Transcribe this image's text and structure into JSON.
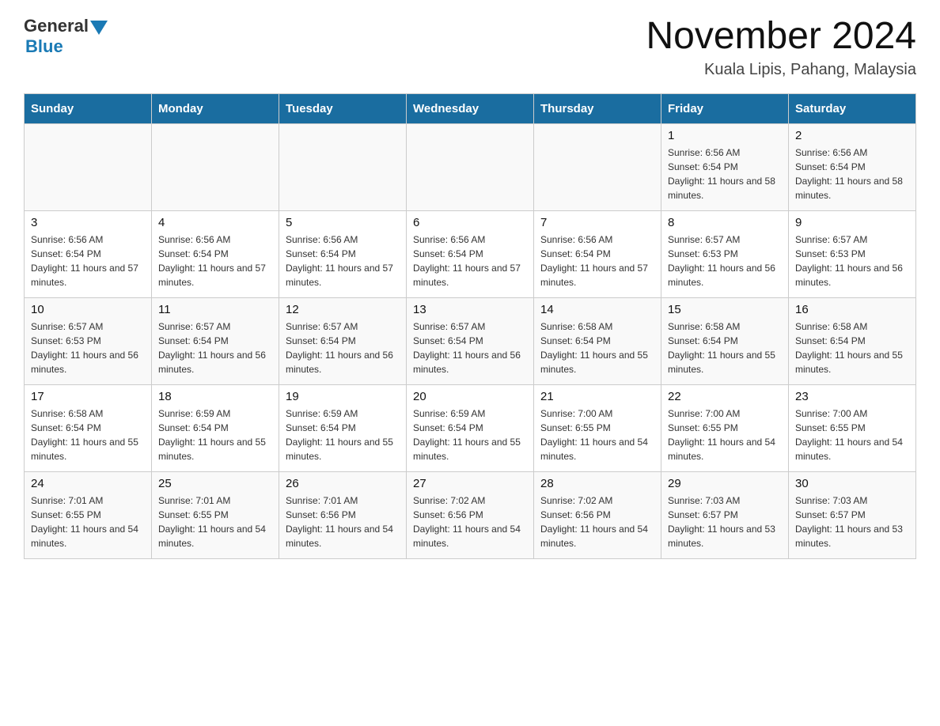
{
  "header": {
    "logo": {
      "general": "General",
      "arrow": "▶",
      "blue": "Blue"
    },
    "title": "November 2024",
    "location": "Kuala Lipis, Pahang, Malaysia"
  },
  "weekdays": [
    "Sunday",
    "Monday",
    "Tuesday",
    "Wednesday",
    "Thursday",
    "Friday",
    "Saturday"
  ],
  "weeks": [
    {
      "days": [
        {
          "date": "",
          "info": ""
        },
        {
          "date": "",
          "info": ""
        },
        {
          "date": "",
          "info": ""
        },
        {
          "date": "",
          "info": ""
        },
        {
          "date": "",
          "info": ""
        },
        {
          "date": "1",
          "info": "Sunrise: 6:56 AM\nSunset: 6:54 PM\nDaylight: 11 hours and 58 minutes."
        },
        {
          "date": "2",
          "info": "Sunrise: 6:56 AM\nSunset: 6:54 PM\nDaylight: 11 hours and 58 minutes."
        }
      ]
    },
    {
      "days": [
        {
          "date": "3",
          "info": "Sunrise: 6:56 AM\nSunset: 6:54 PM\nDaylight: 11 hours and 57 minutes."
        },
        {
          "date": "4",
          "info": "Sunrise: 6:56 AM\nSunset: 6:54 PM\nDaylight: 11 hours and 57 minutes."
        },
        {
          "date": "5",
          "info": "Sunrise: 6:56 AM\nSunset: 6:54 PM\nDaylight: 11 hours and 57 minutes."
        },
        {
          "date": "6",
          "info": "Sunrise: 6:56 AM\nSunset: 6:54 PM\nDaylight: 11 hours and 57 minutes."
        },
        {
          "date": "7",
          "info": "Sunrise: 6:56 AM\nSunset: 6:54 PM\nDaylight: 11 hours and 57 minutes."
        },
        {
          "date": "8",
          "info": "Sunrise: 6:57 AM\nSunset: 6:53 PM\nDaylight: 11 hours and 56 minutes."
        },
        {
          "date": "9",
          "info": "Sunrise: 6:57 AM\nSunset: 6:53 PM\nDaylight: 11 hours and 56 minutes."
        }
      ]
    },
    {
      "days": [
        {
          "date": "10",
          "info": "Sunrise: 6:57 AM\nSunset: 6:53 PM\nDaylight: 11 hours and 56 minutes."
        },
        {
          "date": "11",
          "info": "Sunrise: 6:57 AM\nSunset: 6:54 PM\nDaylight: 11 hours and 56 minutes."
        },
        {
          "date": "12",
          "info": "Sunrise: 6:57 AM\nSunset: 6:54 PM\nDaylight: 11 hours and 56 minutes."
        },
        {
          "date": "13",
          "info": "Sunrise: 6:57 AM\nSunset: 6:54 PM\nDaylight: 11 hours and 56 minutes."
        },
        {
          "date": "14",
          "info": "Sunrise: 6:58 AM\nSunset: 6:54 PM\nDaylight: 11 hours and 55 minutes."
        },
        {
          "date": "15",
          "info": "Sunrise: 6:58 AM\nSunset: 6:54 PM\nDaylight: 11 hours and 55 minutes."
        },
        {
          "date": "16",
          "info": "Sunrise: 6:58 AM\nSunset: 6:54 PM\nDaylight: 11 hours and 55 minutes."
        }
      ]
    },
    {
      "days": [
        {
          "date": "17",
          "info": "Sunrise: 6:58 AM\nSunset: 6:54 PM\nDaylight: 11 hours and 55 minutes."
        },
        {
          "date": "18",
          "info": "Sunrise: 6:59 AM\nSunset: 6:54 PM\nDaylight: 11 hours and 55 minutes."
        },
        {
          "date": "19",
          "info": "Sunrise: 6:59 AM\nSunset: 6:54 PM\nDaylight: 11 hours and 55 minutes."
        },
        {
          "date": "20",
          "info": "Sunrise: 6:59 AM\nSunset: 6:54 PM\nDaylight: 11 hours and 55 minutes."
        },
        {
          "date": "21",
          "info": "Sunrise: 7:00 AM\nSunset: 6:55 PM\nDaylight: 11 hours and 54 minutes."
        },
        {
          "date": "22",
          "info": "Sunrise: 7:00 AM\nSunset: 6:55 PM\nDaylight: 11 hours and 54 minutes."
        },
        {
          "date": "23",
          "info": "Sunrise: 7:00 AM\nSunset: 6:55 PM\nDaylight: 11 hours and 54 minutes."
        }
      ]
    },
    {
      "days": [
        {
          "date": "24",
          "info": "Sunrise: 7:01 AM\nSunset: 6:55 PM\nDaylight: 11 hours and 54 minutes."
        },
        {
          "date": "25",
          "info": "Sunrise: 7:01 AM\nSunset: 6:55 PM\nDaylight: 11 hours and 54 minutes."
        },
        {
          "date": "26",
          "info": "Sunrise: 7:01 AM\nSunset: 6:56 PM\nDaylight: 11 hours and 54 minutes."
        },
        {
          "date": "27",
          "info": "Sunrise: 7:02 AM\nSunset: 6:56 PM\nDaylight: 11 hours and 54 minutes."
        },
        {
          "date": "28",
          "info": "Sunrise: 7:02 AM\nSunset: 6:56 PM\nDaylight: 11 hours and 54 minutes."
        },
        {
          "date": "29",
          "info": "Sunrise: 7:03 AM\nSunset: 6:57 PM\nDaylight: 11 hours and 53 minutes."
        },
        {
          "date": "30",
          "info": "Sunrise: 7:03 AM\nSunset: 6:57 PM\nDaylight: 11 hours and 53 minutes."
        }
      ]
    }
  ]
}
